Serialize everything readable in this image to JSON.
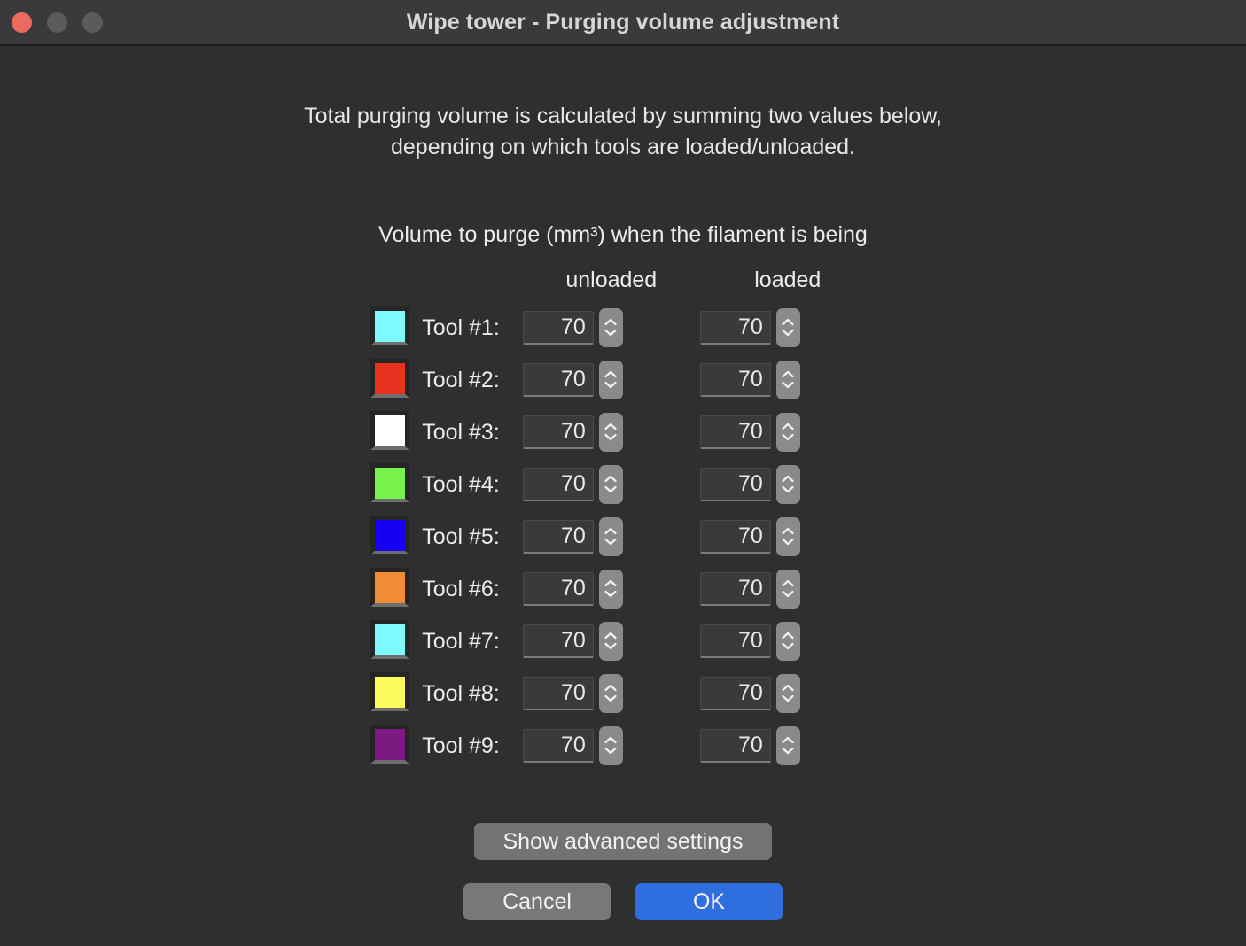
{
  "window": {
    "title": "Wipe tower - Purging volume adjustment",
    "controls": [
      {
        "name": "close",
        "color": "#ed6a5e"
      },
      {
        "name": "minimize",
        "color": "#5b5b5b"
      },
      {
        "name": "zoom",
        "color": "#5b5b5b"
      }
    ],
    "background": "#2f2f2f",
    "titlebar_background": "#3a3a3a"
  },
  "intro": {
    "line1": "Total purging volume is calculated by summing two values below,",
    "line2": "depending on which tools are loaded/unloaded."
  },
  "section": {
    "title": "Volume to purge (mm³) when the filament is being",
    "columns": {
      "swatch": "",
      "label": "",
      "unloaded": "unloaded",
      "loaded": "loaded"
    }
  },
  "tools": [
    {
      "label": "Tool #1:",
      "color": "#7cfaff",
      "unloaded": "70",
      "loaded": "70"
    },
    {
      "label": "Tool #2:",
      "color": "#e8311f",
      "unloaded": "70",
      "loaded": "70"
    },
    {
      "label": "Tool #3:",
      "color": "#ffffff",
      "unloaded": "70",
      "loaded": "70"
    },
    {
      "label": "Tool #4:",
      "color": "#78f24c",
      "unloaded": "70",
      "loaded": "70"
    },
    {
      "label": "Tool #5:",
      "color": "#1500f5",
      "unloaded": "70",
      "loaded": "70"
    },
    {
      "label": "Tool #6:",
      "color": "#ef8c35",
      "unloaded": "70",
      "loaded": "70"
    },
    {
      "label": "Tool #7:",
      "color": "#7cfaff",
      "unloaded": "70",
      "loaded": "70"
    },
    {
      "label": "Tool #8:",
      "color": "#fbfb5e",
      "unloaded": "70",
      "loaded": "70"
    },
    {
      "label": "Tool #9:",
      "color": "#7b1a80",
      "unloaded": "70",
      "loaded": "70"
    }
  ],
  "buttons": {
    "advanced": "Show advanced settings",
    "cancel": "Cancel",
    "ok": "OK",
    "ok_color": "#2f6ede",
    "cancel_color": "#787878"
  }
}
